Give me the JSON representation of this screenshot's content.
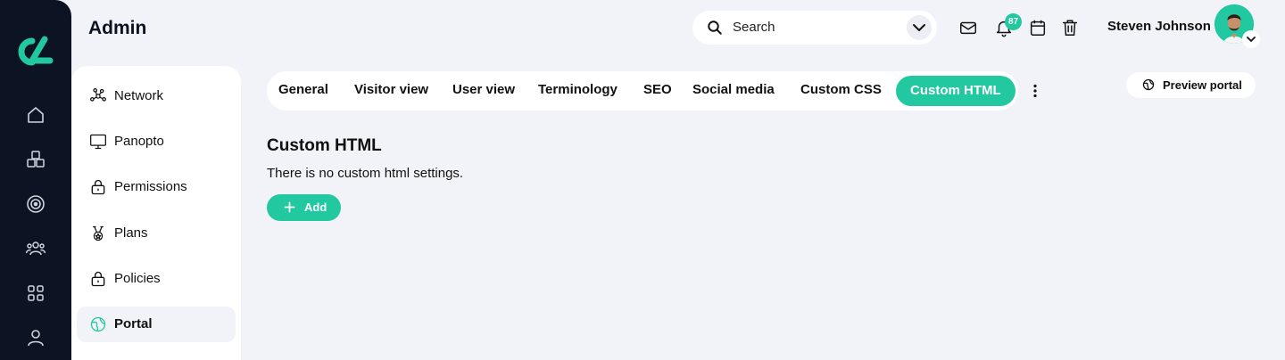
{
  "colors": {
    "accent": "#22c8a0",
    "rail": "#0c1322",
    "background": "#f1f3f9"
  },
  "header": {
    "title": "Admin",
    "search_placeholder": "Search",
    "notifications_count": "87",
    "user_name": "Steven Johnson"
  },
  "rail_icons": [
    "logo-icon",
    "home-icon",
    "modules-icon",
    "target-icon",
    "users-icon",
    "apps-grid-icon",
    "profile-icon"
  ],
  "header_icons": [
    "mail-icon",
    "bell-icon",
    "calendar-icon",
    "trash-icon"
  ],
  "subnav": {
    "items": [
      {
        "label": "Network",
        "icon": "network-icon"
      },
      {
        "label": "Panopto",
        "icon": "monitor-icon"
      },
      {
        "label": "Permissions",
        "icon": "lock-icon"
      },
      {
        "label": "Plans",
        "icon": "medal-icon"
      },
      {
        "label": "Policies",
        "icon": "lock-icon"
      },
      {
        "label": "Portal",
        "icon": "globe-icon",
        "active": true
      }
    ]
  },
  "tabs": [
    {
      "label": "General"
    },
    {
      "label": "Visitor view"
    },
    {
      "label": "User view"
    },
    {
      "label": "Terminology"
    },
    {
      "label": "SEO"
    },
    {
      "label": "Social media"
    },
    {
      "label": "Custom CSS"
    },
    {
      "label": "Custom HTML",
      "active": true
    }
  ],
  "preview_button": {
    "label": "Preview portal"
  },
  "content": {
    "title": "Custom HTML",
    "empty_text": "There is no custom html settings.",
    "add_label": "Add"
  }
}
